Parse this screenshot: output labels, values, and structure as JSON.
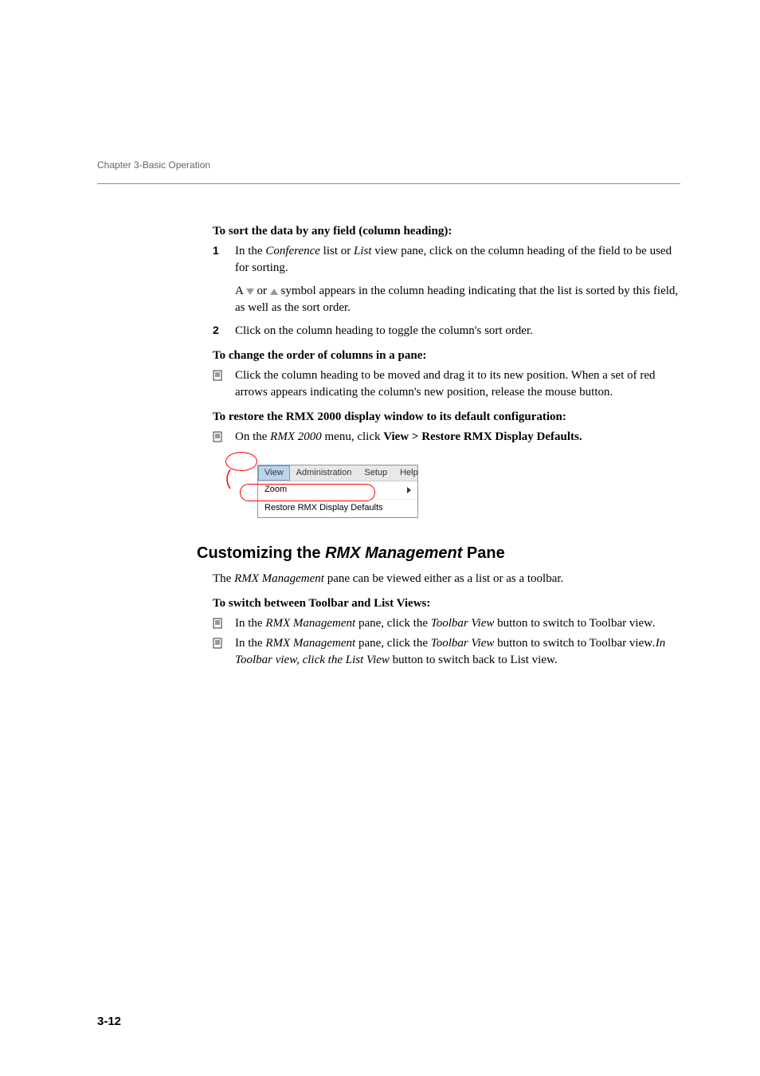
{
  "chapter": "Chapter 3-Basic Operation",
  "page_number": "3-12",
  "h1": {
    "sort_heading": "To sort the data by any field (column heading):",
    "step1_a": "In the ",
    "step1_i1": "Conference",
    "step1_b": " list or ",
    "step1_i2": "List",
    "step1_c": " view pane, click on the column heading of the field to be used for sorting.",
    "sub_a": "A ",
    "sub_b": " or ",
    "sub_c": " symbol appears in the column heading indicating that the list is sorted by this field, as well as the sort order.",
    "step2": "Click on the column heading to toggle the column's sort order."
  },
  "h2": {
    "heading": "To change the order of columns in a pane:",
    "bullet": "Click the column heading to be moved and drag it to its new position. When a set of red arrows appears indicating the column's new position, release the mouse button."
  },
  "h3": {
    "heading": "To restore the RMX 2000 display window to its default configuration:",
    "bullet_a": "On the ",
    "bullet_i": "RMX 2000",
    "bullet_b": " menu, click ",
    "bullet_bold": "View > Restore RMX Display Defaults."
  },
  "menu": {
    "view": "View",
    "admin": "Administration",
    "setup": "Setup",
    "help": "Help",
    "zoom": "Zoom",
    "restore": "Restore RMX Display Defaults"
  },
  "section": {
    "title_a": "Customizing the ",
    "title_i": "RMX Management",
    "title_b": " Pane",
    "intro_a": "The ",
    "intro_i": "RMX Management",
    "intro_b": " pane can be viewed either as a list or as a toolbar.",
    "switch_heading": "To switch between Toolbar and List Views:",
    "b1_a": "In the ",
    "b1_i1": "RMX Management",
    "b1_b": " pane, click the ",
    "b1_i2": "Toolbar View",
    "b1_c": " button to switch to Toolbar view",
    "b1_d": ".",
    "b2_a": "In the ",
    "b2_i1": "RMX Management",
    "b2_b": " pane, click the ",
    "b2_i2": "Toolbar View",
    "b2_c": " button to switch to Toolbar view",
    "b2_d": ".In Toolbar view",
    "b2_e": ", click the ",
    "b2_i3": "List View",
    "b2_f": " button to switch back to List view."
  }
}
